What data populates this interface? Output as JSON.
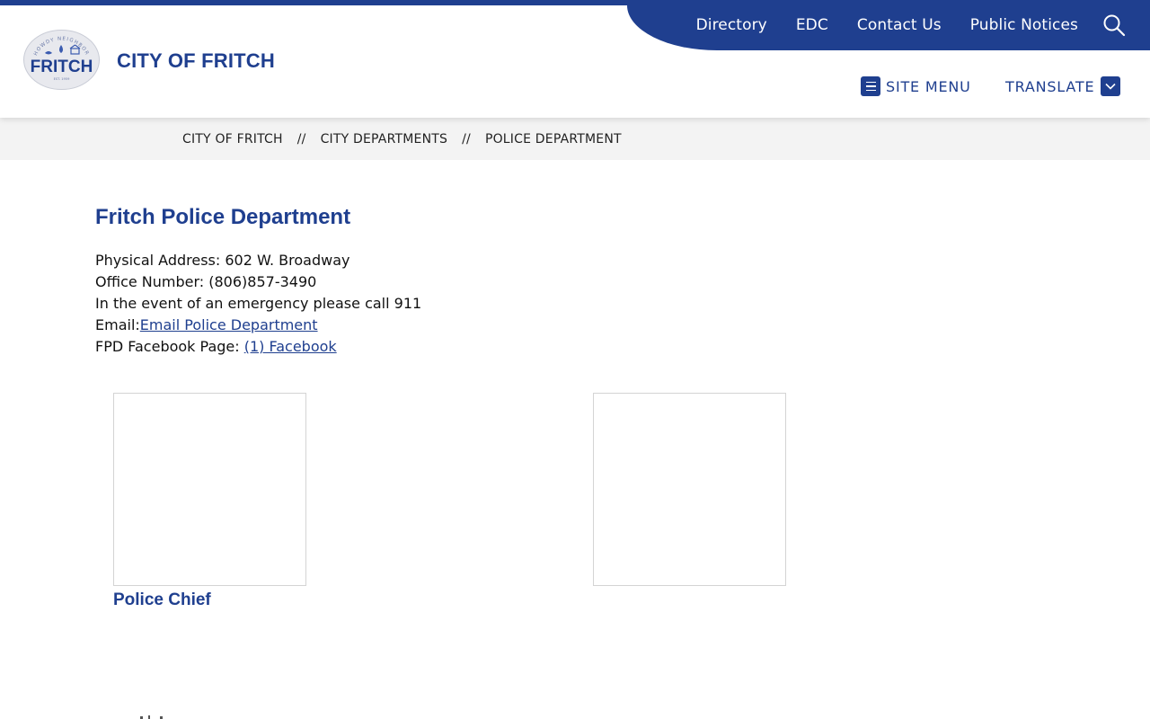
{
  "header": {
    "site_title": "CITY OF FRITCH",
    "logo": {
      "arc_text": "HOWDY NEIGHBOR",
      "name": "FRITCH",
      "est": "EST. 1959"
    },
    "utility_nav": [
      "Directory",
      "EDC",
      "Contact Us",
      "Public Notices"
    ],
    "site_menu_label": "SITE MENU",
    "translate_label": "TRANSLATE"
  },
  "breadcrumb": [
    "CITY OF FRITCH",
    "CITY DEPARTMENTS",
    "POLICE DEPARTMENT"
  ],
  "breadcrumb_separator": "//",
  "main": {
    "title": "Fritch Police Department",
    "address": "Physical Address: 602 W. Broadway",
    "office": "Office Number: (806)857-3490",
    "emergency": "In the event of an emergency please call 911",
    "email_label": "Email:",
    "email_link": "Email Police Department",
    "facebook_label": "FPD Facebook Page: ",
    "facebook_link": "(1) Facebook",
    "staff": [
      {
        "title": "Police Chief"
      },
      {
        "title": ""
      }
    ]
  },
  "colors": {
    "brand": "#1f3f8f",
    "breadcrumb_bg": "#f3f3f3"
  }
}
